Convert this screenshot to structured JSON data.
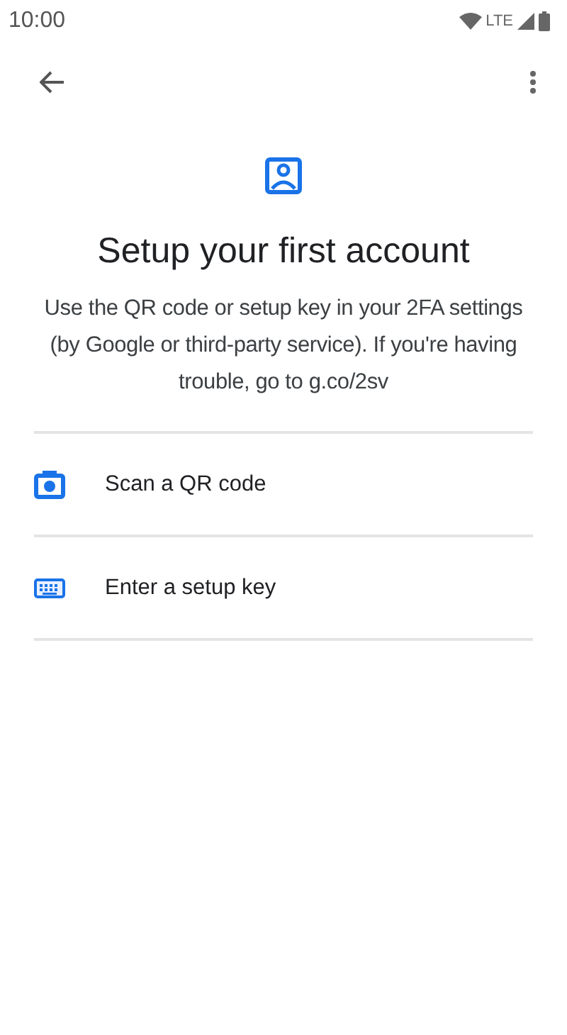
{
  "status_bar": {
    "time": "10:00",
    "network": "LTE"
  },
  "title": "Setup your first account",
  "description": "Use the QR code or setup key in your 2FA settings (by Google or third-party service). If you're having trouble, go to g.co/2sv",
  "options": [
    {
      "kind": "camera",
      "label": "Scan a QR code"
    },
    {
      "kind": "keyboard",
      "label": "Enter a setup key"
    }
  ]
}
